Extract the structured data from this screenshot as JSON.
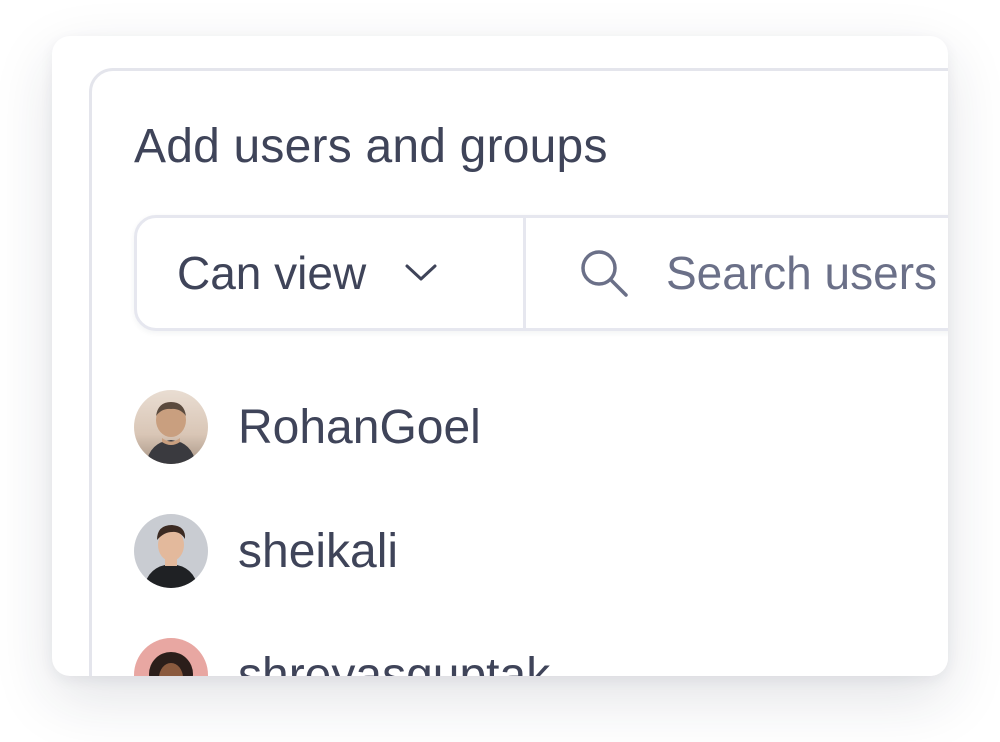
{
  "dialog": {
    "title": "Add users and groups"
  },
  "permission": {
    "selected": "Can view"
  },
  "search": {
    "placeholder": "Search users"
  },
  "users": [
    {
      "name": "RohanGoel"
    },
    {
      "name": "sheikali"
    },
    {
      "name": "shreyasguptak"
    }
  ],
  "colors": {
    "text": "#3f4459",
    "placeholder": "#6b7088",
    "border": "#e4e5ec"
  },
  "icons": {
    "permission_chevron": "chevron-down-icon",
    "search": "search-icon"
  }
}
